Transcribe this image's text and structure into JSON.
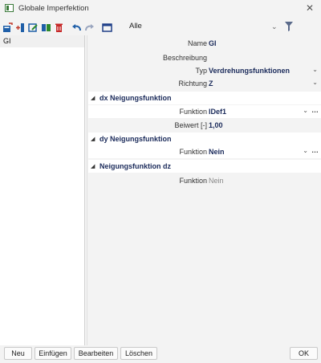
{
  "window": {
    "title": "Globale Imperfektion"
  },
  "toolbar": {
    "icons": [
      "new-icon",
      "insert-icon",
      "edit-icon",
      "copy-icon",
      "delete-icon",
      "undo-icon",
      "redo-icon",
      "table-icon"
    ],
    "filter_value": "Alle"
  },
  "list": {
    "items": [
      {
        "label": "GI"
      }
    ]
  },
  "properties": {
    "name": {
      "label": "Name",
      "value": "GI"
    },
    "beschreibung": {
      "label": "Beschreibung",
      "value": ""
    },
    "typ": {
      "label": "Typ",
      "value": "Verdrehungsfunktionen"
    },
    "richtung": {
      "label": "Richtung",
      "value": "Z"
    },
    "dx": {
      "title": "dx Neigungsfunktion",
      "funktion": {
        "label": "Funktion",
        "value": "IDef1"
      },
      "beiwert": {
        "label": "Beiwert [-]",
        "value": "1,00"
      }
    },
    "dy": {
      "title": "dy Neigungsfunktion",
      "funktion": {
        "label": "Funktion",
        "value": "Nein"
      }
    },
    "dz": {
      "title": "Neigungsfunktion dz",
      "funktion": {
        "label": "Funktion",
        "value": "Nein"
      }
    }
  },
  "buttons": {
    "neu": "Neu",
    "einfuegen": "Einfügen",
    "bearbeiten": "Bearbeiten",
    "loeschen": "Löschen",
    "ok": "OK"
  }
}
